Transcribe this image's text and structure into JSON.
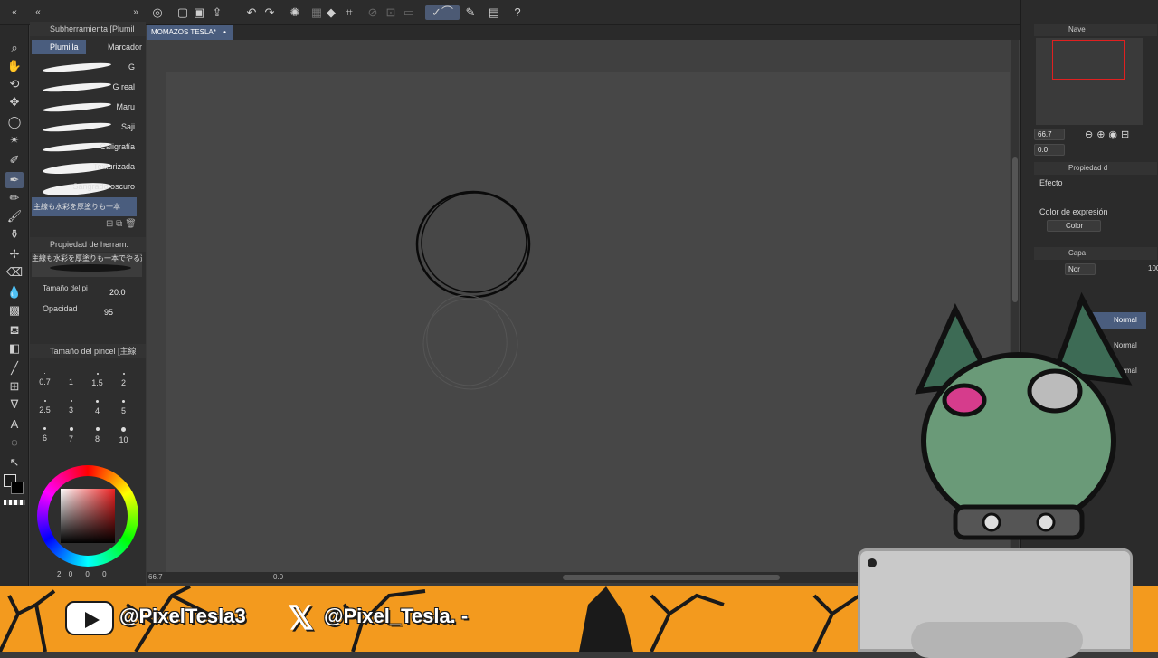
{
  "subtool": {
    "header": "Subherramienta [Plumil",
    "tabs": [
      "Plumilla",
      "Marcador"
    ],
    "brushes": [
      "G",
      "G real",
      "Maru",
      "Saji",
      "Caligrafía",
      "Texturizada",
      "Sangrado oscuro",
      "主線も水彩を厚塗りも一本"
    ]
  },
  "tool_property": {
    "header": "Propiedad de herram.",
    "brush_name": "主線も水彩を厚塗りも一本でやる透けがい",
    "size_label": "Tamaño del pi",
    "size_value": "20.0",
    "opacity_label": "Opacidad",
    "opacity_value": "95"
  },
  "brush_size": {
    "header": "Tamaño del pincel [主線",
    "sizes": [
      "0.7",
      "1",
      "1.5",
      "2",
      "2.5",
      "3",
      "4",
      "5",
      "6",
      "7",
      "8",
      "10"
    ]
  },
  "color_info": {
    "values": [
      "2",
      "0",
      "0",
      "0"
    ]
  },
  "document": {
    "tab_title": "MOMAZOS TESLA*"
  },
  "status": {
    "zoom": "66.7",
    "angle": "0.0"
  },
  "navigator": {
    "header": "Nave",
    "zoom": "66.7",
    "rotation": "0.0"
  },
  "layer_property": {
    "header": "Propiedad d",
    "effect_label": "Efecto",
    "expression_label": "Color de expresión",
    "expression_value": "Color"
  },
  "layers": {
    "header": "Capa",
    "blend_mode": "Nor",
    "opacity": "100",
    "rows": [
      "Normal",
      "Normal",
      "Normal"
    ]
  },
  "banner": {
    "youtube": "@PixelTesla3",
    "x_handle": "@Pixel_Tesla. -"
  }
}
